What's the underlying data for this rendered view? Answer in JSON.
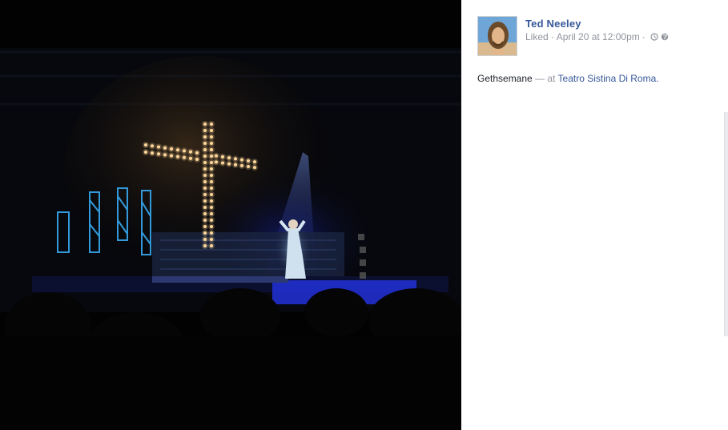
{
  "post": {
    "author_name": "Ted Neeley",
    "liked_label": "Liked",
    "separator": "·",
    "timestamp": "April 20 at 12:00pm",
    "clock_icon": "clock-icon",
    "privacy_icon": "globe-icon",
    "caption_text": "Gethsemane",
    "caption_dash": "—",
    "at_label": "at",
    "place_name": "Teatro Sistina Di Roma."
  },
  "colors": {
    "link": "#365899",
    "muted": "#90949c",
    "text": "#1d2129",
    "stage_light": "#2a3cff",
    "cross_bulb": "#ffd89a"
  }
}
